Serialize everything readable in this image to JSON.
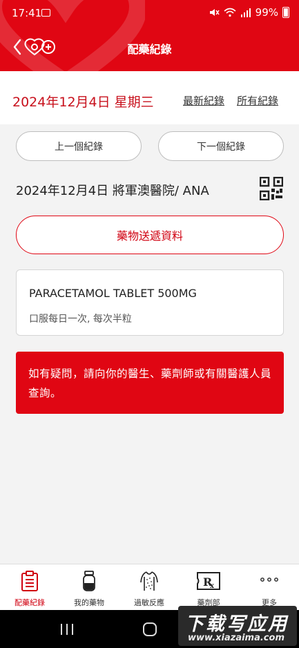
{
  "status_bar": {
    "time": "17:41",
    "battery": "99%"
  },
  "header": {
    "title": "配藥紀錄"
  },
  "date_bar": {
    "date": "2024年12月4日 星期三",
    "latest_link": "最新紀錄",
    "all_link": "所有紀錄"
  },
  "nav": {
    "prev": "上一個紀錄",
    "next": "下一個紀錄"
  },
  "record": {
    "title": "2024年12月4日 將軍澳醫院/ ANA",
    "delivery_button": "藥物送遞資料"
  },
  "medication": {
    "name": "PARACETAMOL TABLET 500MG",
    "dosage": "口服每日一次, 每次半粒"
  },
  "notice": {
    "text": "如有疑問，請向你的醫生、藥劑師或有關醫護人員查詢。"
  },
  "tabs": [
    {
      "label": "配藥紀錄",
      "icon": "dispensing-record-icon",
      "active": true
    },
    {
      "label": "我的藥物",
      "icon": "pill-bottle-icon",
      "active": false
    },
    {
      "label": "過敏反應",
      "icon": "allergy-body-icon",
      "active": false
    },
    {
      "label": "藥劑部",
      "icon": "rx-icon",
      "active": false
    },
    {
      "label": "更多",
      "icon": "more-dots-icon",
      "active": false
    }
  ],
  "watermark": {
    "line1": "下载写应用",
    "line2": "www.xiazaima.com"
  },
  "colors": {
    "brand_red": "#e00613"
  }
}
